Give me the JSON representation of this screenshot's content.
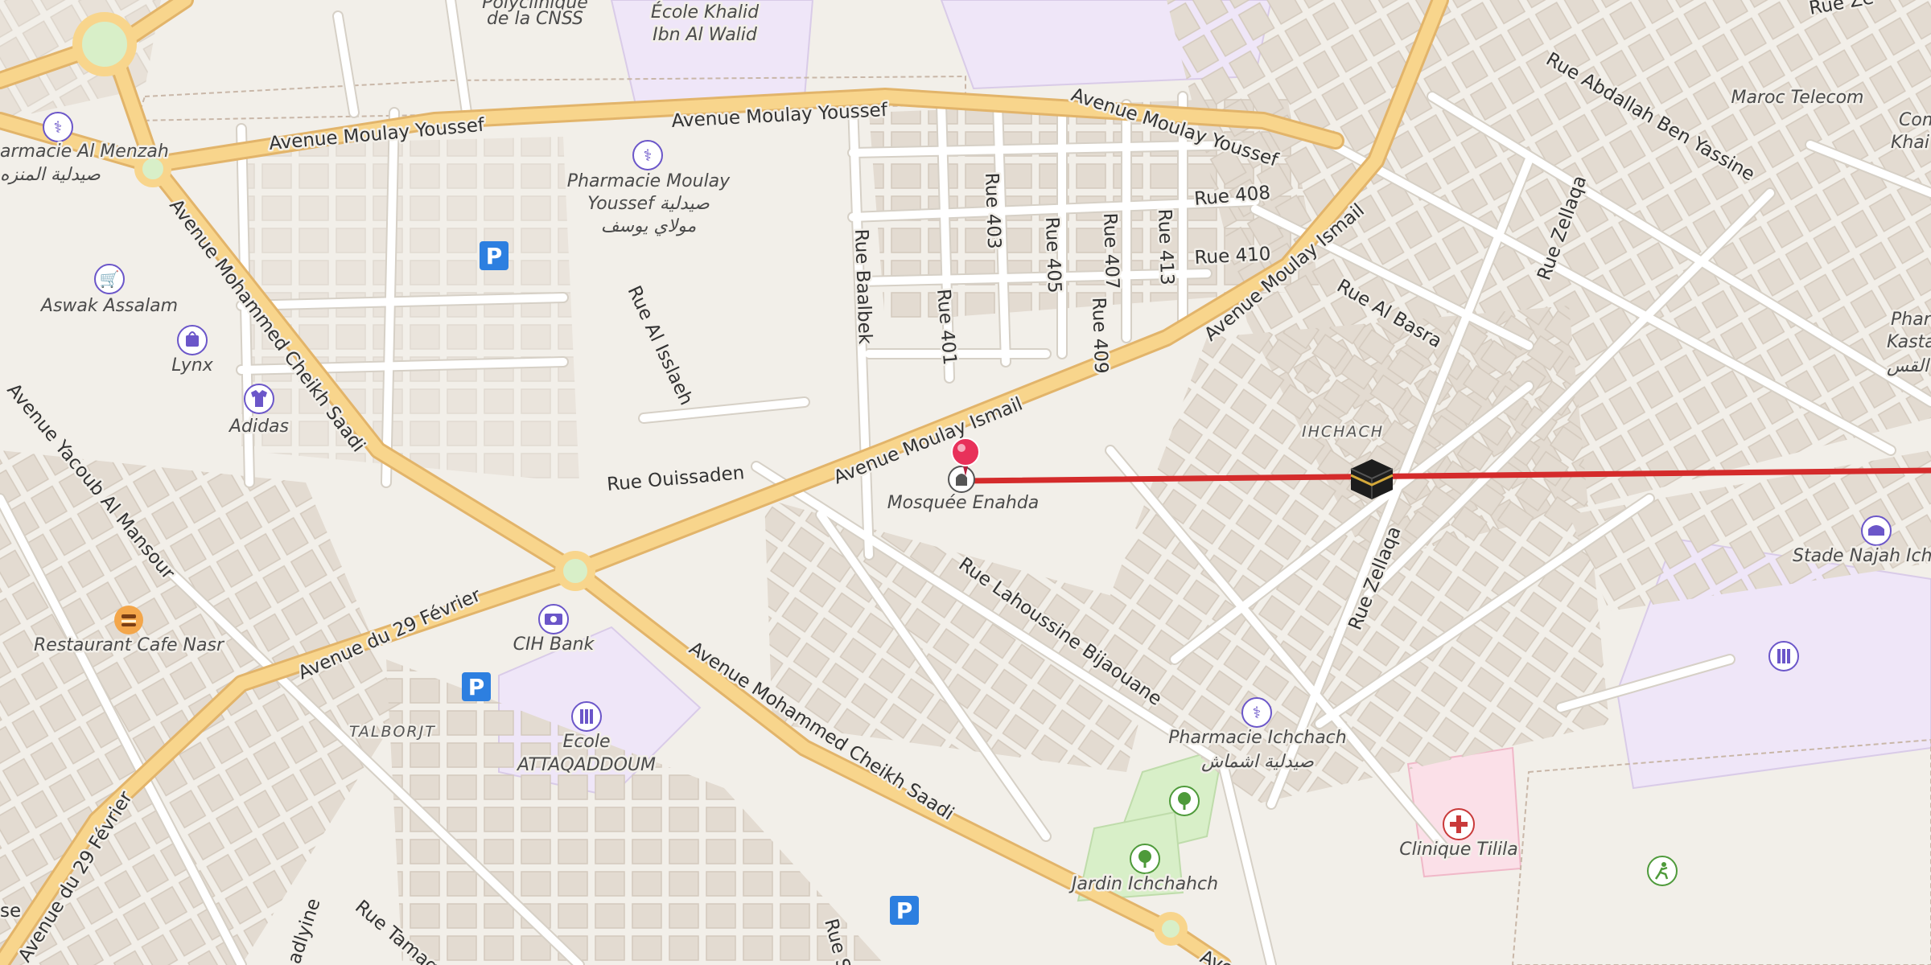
{
  "map": {
    "colors": {
      "land": "#f2efe9",
      "building": "#e3dbd1",
      "building_edge": "#d3c9bd",
      "primary_road": "#f8d58c",
      "primary_casing": "#e2b46a",
      "minor_road": "#ffffff",
      "minor_casing": "#d6d0c6",
      "school_area": "#efe6f8",
      "park": "#d8efc8",
      "hospital": "#fbe0e8",
      "route_line": "#d42b2b",
      "marker": "#e8315a",
      "poi_icon": "#6b56c9",
      "parking": "#2d7fe0"
    },
    "road_labels": [
      "Avenue Moulay Youssef",
      "Avenue Moulay Youssef",
      "Avenue Moulay Youssef",
      "Avenue Moulay Ismail",
      "Avenue Moulay Ismail",
      "Avenue Mohammed Cheikh Saadi",
      "Avenue Mohammed Cheikh Saadi",
      "Avenue du 29 Février",
      "Avenue du 29 Février",
      "Avenue Yacoub Al Mansour",
      "Rue Ouissaden",
      "Rue Al Isslaeh",
      "Rue Baalbek",
      "Rue 401",
      "Rue 403",
      "Rue 405",
      "Rue 407",
      "Rue 409",
      "Rue 413",
      "Rue 408",
      "Rue 410",
      "Rue Al Basra",
      "Rue Zellaqa",
      "Rue Zellaqa",
      "Rue Abdallah Ben Yassine",
      "Rue Lahoussine Bijaouane",
      "Rue Tamag",
      "Rue Ze",
      "Rue S",
      "Avenu",
      "adlyine",
      "se"
    ],
    "poi_labels": {
      "ecole_khalid": [
        "École Khalid",
        "Ibn Al Walid"
      ],
      "cnss": [
        "Polyclinique",
        "de la CNSS"
      ],
      "pharmacie_al_menzah": [
        "armacie Al Menzah",
        "صيدلية المنزه"
      ],
      "pharmacie_moulay_youssef": [
        "Pharmacie Moulay",
        "Youssef صيدلية",
        "مولاي يوسف"
      ],
      "aswak": "Aswak Assalam",
      "lynx": "Lynx",
      "adidas": "Adidas",
      "mosquee": "Mosquée Enahda",
      "restaurant": "Restaurant Cafe Nasr",
      "cih": "CIH Bank",
      "ecole_attaqaddoum": [
        "Ecole",
        "ATTAQADDOUM"
      ],
      "pharmacie_ichchach": [
        "Pharmacie Ichchach",
        "صيدلية اشماش"
      ],
      "jardin": "Jardin Ichchahch",
      "clinique": "Clinique Tilila",
      "stade": "Stade Najah Ichc",
      "maroc_telecom": "Maroc Telecom",
      "pharmacie_kastalani": [
        "Pharm",
        "Kastalan",
        "القس"
      ],
      "com_khai": [
        "Com",
        "Khai"
      ]
    },
    "district_labels": [
      "IHCHACH",
      "TALBORJT"
    ],
    "icons": [
      "pharmacy-icon",
      "pharmacy-icon",
      "pharmacy-icon",
      "parking-icon",
      "parking-icon",
      "parking-icon",
      "shopping-cart-icon",
      "shopping-bag-icon",
      "clothes-icon",
      "restaurant-icon",
      "bank-icon",
      "school-icon",
      "school-icon",
      "park-icon",
      "park-icon",
      "hospital-icon",
      "stadium-icon",
      "sports-icon",
      "mosque-icon",
      "kaaba-icon",
      "location-marker-icon"
    ]
  }
}
